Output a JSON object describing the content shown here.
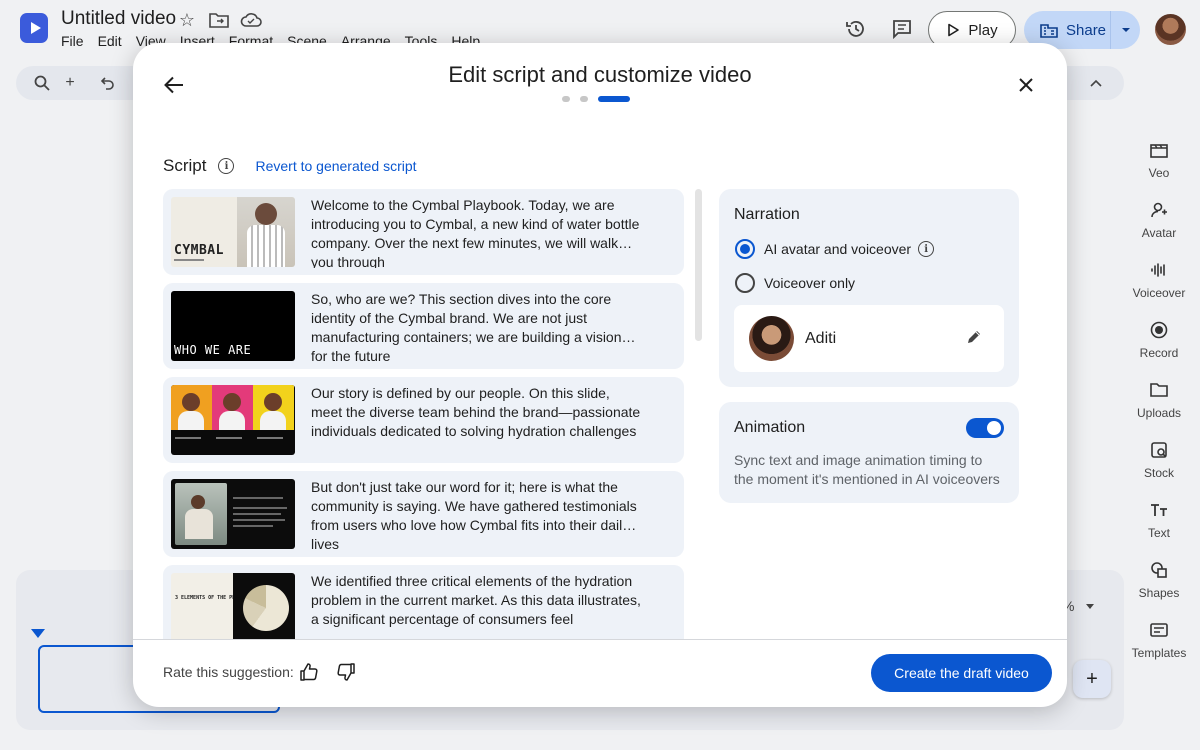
{
  "app": {
    "title": "Untitled video",
    "menu": [
      "File",
      "Edit",
      "View",
      "Insert",
      "Format",
      "Scene",
      "Arrange",
      "Tools",
      "Help"
    ],
    "play_label": "Play",
    "share_label": "Share",
    "accent_color": "#0b57d0"
  },
  "rail": [
    {
      "label": "Veo",
      "icon": "veo-icon"
    },
    {
      "label": "Avatar",
      "icon": "avatar-icon"
    },
    {
      "label": "Voiceover",
      "icon": "voiceover-icon"
    },
    {
      "label": "Record",
      "icon": "record-icon"
    },
    {
      "label": "Uploads",
      "icon": "folder-icon"
    },
    {
      "label": "Stock",
      "icon": "stock-icon"
    },
    {
      "label": "Text",
      "icon": "text-icon"
    },
    {
      "label": "Shapes",
      "icon": "shapes-icon"
    },
    {
      "label": "Templates",
      "icon": "templates-icon"
    }
  ],
  "timeline": {
    "zoom_suffix": "%"
  },
  "modal": {
    "title": "Edit script and customize video",
    "steps_total": 3,
    "step_current": 3,
    "script_label": "Script",
    "revert_label": "Revert to generated script",
    "scenes": [
      {
        "thumb_text": "CYMBAL",
        "text": "Welcome to the Cymbal Playbook. Today, we are introducing you to Cymbal, a new kind of water bottle company. Over the next few minutes, we will walk you through"
      },
      {
        "thumb_text": "WHO WE ARE",
        "text": "So, who are we? This section dives into the core identity of the Cymbal brand. We are not just manufacturing containers; we are building a vision for the future"
      },
      {
        "thumb_text": "",
        "text": "Our story is defined by our people. On this slide, meet the diverse team behind the brand—passionate individuals dedicated to solving hydration challenges"
      },
      {
        "thumb_text": "",
        "text": "But don't just take our word for it; here is what the community is saying. We have gathered testimonials from users who love how Cymbal fits into their daily lives"
      },
      {
        "thumb_text": "3 ELEMENTS OF THE PROBLEM",
        "text": "We identified three critical elements of the hydration problem in the current market. As this data illustrates, a significant percentage of consumers feel"
      }
    ],
    "narration": {
      "title": "Narration",
      "options": [
        {
          "label": "AI avatar and voiceover",
          "selected": true
        },
        {
          "label": "Voiceover only",
          "selected": false
        }
      ],
      "voice_name": "Aditi"
    },
    "animation": {
      "title": "Animation",
      "enabled": true,
      "description": "Sync text and image animation timing to the moment it's mentioned in AI voiceovers"
    },
    "footer": {
      "rate_label": "Rate this suggestion:",
      "create_label": "Create the draft video"
    }
  }
}
